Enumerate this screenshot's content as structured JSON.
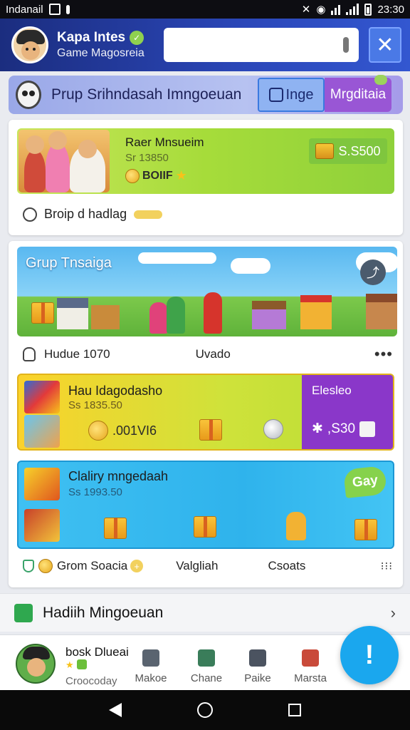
{
  "status_bar": {
    "carrier": "Indanail",
    "time": "23:30"
  },
  "header": {
    "name": "Kapa Intes",
    "subtitle": "Game Magosreia",
    "search": {
      "value": "",
      "placeholder": ""
    }
  },
  "group_bar": {
    "title": "Prup Srihndasah Imngoeuan",
    "tabs": [
      {
        "label": "Inge"
      },
      {
        "label": "Mrgditaia"
      }
    ]
  },
  "card1": {
    "title": "Raer Mnsueim",
    "subtitle": "Sr 13850",
    "coins": "BOIIF",
    "price": "S.S500",
    "footer": "Broip d hadlag"
  },
  "card2": {
    "banner_title": "Grup Tnsaiga",
    "meta_left": "Hudue 1070",
    "meta_mid": "Uvado",
    "offer1": {
      "title": "Hau Idagodasho",
      "subtitle": "Ss 1835.50",
      "coins": ".001VI6",
      "side_title": "Elesleo",
      "side_price": ",S30"
    },
    "offer2": {
      "title": "Claliry mngedaah",
      "subtitle": "Ss 1993.50",
      "badge": "Gay"
    },
    "footer_left": "Grom Soacia",
    "footer_mid": "Valgliah",
    "footer_right": "Csoats"
  },
  "hadiah": {
    "label": "Hadiih Mingoeuan"
  },
  "bottom_nav": {
    "user_name": "bosk Dlueai",
    "user_sub": "Croocoday",
    "items": [
      {
        "label": "Makoe"
      },
      {
        "label": "Chane"
      },
      {
        "label": "Paike"
      },
      {
        "label": "Marsta"
      }
    ],
    "fab_label": "!"
  },
  "colors": {
    "header": "#2b47b9",
    "accent_green": "#8fd13a",
    "accent_purple": "#8a37c9",
    "accent_blue": "#1aa7ee"
  }
}
